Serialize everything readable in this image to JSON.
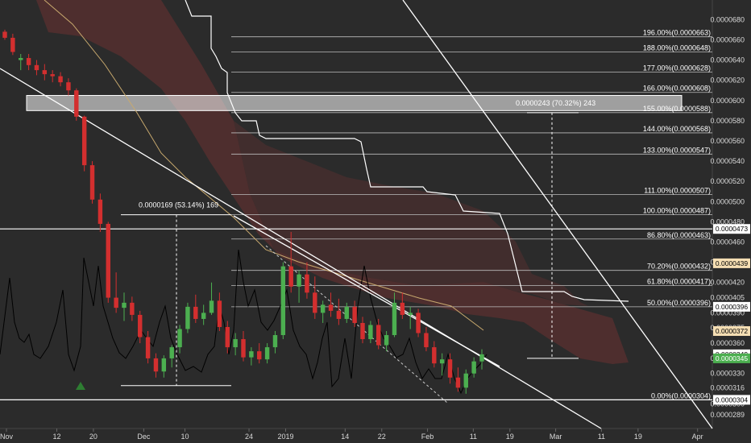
{
  "chart_data": {
    "type": "candlestick",
    "title": "",
    "y_axis": {
      "range": [
        2.82e-05,
        6.93e-05
      ],
      "ticks": [
        "0.0000680",
        "0.0000660",
        "0.0000640",
        "0.0000620",
        "0.0000600",
        "0.0000580",
        "0.0000560",
        "0.0000540",
        "0.0000520",
        "0.0000500",
        "0.0000480",
        "0.0000460",
        "0.0000440",
        "0.0000420",
        "0.0000405",
        "0.0000390",
        "0.0000375",
        "0.0000360",
        "0.0000345",
        "0.0000330",
        "0.0000316",
        "0.0000300",
        "0.0000289"
      ],
      "position": "right"
    },
    "x_axis": {
      "ticks": [
        {
          "label": "Nov",
          "day": 0
        },
        {
          "label": "12",
          "day": 11
        },
        {
          "label": "20",
          "day": 19
        },
        {
          "label": "Dec",
          "day": 30
        },
        {
          "label": "10",
          "day": 39
        },
        {
          "label": "24",
          "day": 53
        },
        {
          "label": "2019",
          "day": 61
        },
        {
          "label": "14",
          "day": 74
        },
        {
          "label": "22",
          "day": 82
        },
        {
          "label": "Feb",
          "day": 92
        },
        {
          "label": "11",
          "day": 102
        },
        {
          "label": "19",
          "day": 110
        },
        {
          "label": "Mar",
          "day": 120
        },
        {
          "label": "11",
          "day": 130
        },
        {
          "label": "19",
          "day": 138
        },
        {
          "label": "Apr",
          "day": 151
        }
      ]
    },
    "fib_levels": [
      {
        "label": "0.00%(0.0000304)",
        "price": 3.04e-05
      },
      {
        "label": "50.00%(0.0000396)",
        "price": 3.96e-05
      },
      {
        "label": "61.80%(0.0000417)",
        "price": 4.17e-05
      },
      {
        "label": "70.20%(0.0000432)",
        "price": 4.32e-05
      },
      {
        "label": "86.80%(0.0000463)",
        "price": 4.63e-05
      },
      {
        "label": "100.00%(0.0000487)",
        "price": 4.87e-05
      },
      {
        "label": "111.00%(0.0000507)",
        "price": 5.07e-05
      },
      {
        "label": "133.00%(0.0000547)",
        "price": 5.47e-05
      },
      {
        "label": "144.00%(0.0000568)",
        "price": 5.68e-05
      },
      {
        "label": "155.00%(0.0000588)",
        "price": 5.88e-05
      },
      {
        "label": "166.00%(0.0000608)",
        "price": 6.08e-05
      },
      {
        "label": "177.00%(0.0000628)",
        "price": 6.28e-05
      },
      {
        "label": "188.00%(0.0000648)",
        "price": 6.48e-05
      },
      {
        "label": "196.00%(0.0000663)",
        "price": 6.63e-05
      }
    ],
    "measurements": [
      {
        "label": "0.0000169 (53.14%) 169",
        "from_price": 3.18e-05,
        "to_price": 4.87e-05
      },
      {
        "label": "0.0000243 (70.32%) 243",
        "from_price": 3.45e-05,
        "to_price": 5.88e-05
      }
    ],
    "horizontal_lines": [
      4.73e-05,
      3.04e-05
    ],
    "resistance_zone": {
      "from_price": 5.9e-05,
      "to_price": 6.05e-05
    },
    "price_tags": [
      {
        "text": "0.0000473",
        "price": 4.73e-05,
        "bg": "#ffffff",
        "fg": "#000000"
      },
      {
        "text": "0.0000439",
        "price": 4.39e-05,
        "bg": "#f5deb3",
        "fg": "#000000"
      },
      {
        "text": "0.0000396",
        "price": 3.96e-05,
        "bg": "#ffffff",
        "fg": "#000000"
      },
      {
        "text": "0.0000372",
        "price": 3.72e-05,
        "bg": "#f5deb3",
        "fg": "#000000"
      },
      {
        "text": "0.0000349",
        "price": 3.49e-05,
        "bg": "#ffffff",
        "fg": "#000000"
      },
      {
        "text": "0.0000345",
        "price": 3.45e-05,
        "bg": "#4caf50",
        "fg": "#ffffff"
      },
      {
        "text": "0.0000304",
        "price": 3.04e-05,
        "bg": "#ffffff",
        "fg": "#000000"
      }
    ],
    "candles": [
      [
        6.68e-05,
        6.7e-05,
        6.6e-05,
        6.62e-05
      ],
      [
        6.62e-05,
        6.66e-05,
        6.45e-05,
        6.48e-05
      ],
      [
        6.4e-05,
        6.46e-05,
        6.3e-05,
        6.42e-05
      ],
      [
        6.42e-05,
        6.46e-05,
        6.3e-05,
        6.35e-05
      ],
      [
        6.35e-05,
        6.4e-05,
        6.25e-05,
        6.3e-05
      ],
      [
        6.3e-05,
        6.36e-05,
        6.2e-05,
        6.26e-05
      ],
      [
        6.26e-05,
        6.3e-05,
        6.18e-05,
        6.24e-05
      ],
      [
        6.24e-05,
        6.28e-05,
        6.14e-05,
        6.18e-05
      ],
      [
        6.18e-05,
        6.22e-05,
        6.05e-05,
        6.1e-05
      ],
      [
        6.1e-05,
        6.12e-05,
        5.8e-05,
        5.84e-05
      ],
      [
        5.84e-05,
        5.85e-05,
        5.3e-05,
        5.36e-05
      ],
      [
        5.36e-05,
        5.4e-05,
        4.98e-05,
        5.02e-05
      ],
      [
        5.02e-05,
        5.08e-05,
        4.7e-05,
        4.78e-05
      ],
      [
        4.78e-05,
        4.8e-05,
        4e-05,
        4.05e-05
      ],
      [
        4.05e-05,
        4.3e-05,
        3.9e-05,
        3.95e-05
      ],
      [
        3.95e-05,
        4.1e-05,
        3.82e-05,
        4e-05
      ],
      [
        4e-05,
        4.06e-05,
        3.82e-05,
        3.88e-05
      ],
      [
        3.88e-05,
        3.92e-05,
        3.6e-05,
        3.66e-05
      ],
      [
        3.66e-05,
        3.72e-05,
        3.4e-05,
        3.45e-05
      ],
      [
        3.45e-05,
        3.5e-05,
        3.26e-05,
        3.32e-05
      ],
      [
        3.32e-05,
        3.48e-05,
        3.26e-05,
        3.45e-05
      ],
      [
        3.45e-05,
        3.58e-05,
        3.36e-05,
        3.56e-05
      ],
      [
        3.56e-05,
        3.78e-05,
        3.5e-05,
        3.74e-05
      ],
      [
        3.74e-05,
        4e-05,
        3.7e-05,
        3.96e-05
      ],
      [
        3.96e-05,
        4.08e-05,
        3.8e-05,
        3.84e-05
      ],
      [
        3.84e-05,
        3.98e-05,
        3.78e-05,
        3.9e-05
      ],
      [
        3.9e-05,
        4.2e-05,
        3.88e-05,
        4.02e-05
      ],
      [
        4.02e-05,
        4.1e-05,
        3.72e-05,
        3.76e-05
      ],
      [
        3.76e-05,
        3.82e-05,
        3.5e-05,
        3.56e-05
      ],
      [
        3.56e-05,
        3.7e-05,
        3.48e-05,
        3.64e-05
      ],
      [
        3.64e-05,
        3.72e-05,
        3.42e-05,
        3.46e-05
      ],
      [
        3.46e-05,
        3.56e-05,
        3.38e-05,
        3.52e-05
      ],
      [
        3.52e-05,
        3.6e-05,
        3.4e-05,
        3.44e-05
      ],
      [
        3.44e-05,
        3.6e-05,
        3.4e-05,
        3.56e-05
      ],
      [
        3.56e-05,
        3.72e-05,
        3.5e-05,
        3.68e-05
      ],
      [
        3.68e-05,
        4.4e-05,
        3.64e-05,
        4.36e-05
      ],
      [
        4.36e-05,
        4.7e-05,
        4.1e-05,
        4.16e-05
      ],
      [
        4.16e-05,
        4.32e-05,
        4e-05,
        4.28e-05
      ],
      [
        4.28e-05,
        4.4e-05,
        4.04e-05,
        4.1e-05
      ],
      [
        4.1e-05,
        4.26e-05,
        3.84e-05,
        3.9e-05
      ],
      [
        3.9e-05,
        4.02e-05,
        3.8e-05,
        3.98e-05
      ],
      [
        3.98e-05,
        4.1e-05,
        3.86e-05,
        3.92e-05
      ],
      [
        3.92e-05,
        4.04e-05,
        3.78e-05,
        3.84e-05
      ],
      [
        3.84e-05,
        4e-05,
        3.8e-05,
        3.96e-05
      ],
      [
        3.96e-05,
        4.02e-05,
        3.76e-05,
        3.8e-05
      ],
      [
        3.8e-05,
        3.86e-05,
        3.6e-05,
        3.64e-05
      ],
      [
        3.64e-05,
        3.82e-05,
        3.6e-05,
        3.78e-05
      ],
      [
        3.78e-05,
        3.84e-05,
        3.54e-05,
        3.58e-05
      ],
      [
        3.58e-05,
        3.72e-05,
        3.52e-05,
        3.68e-05
      ],
      [
        3.68e-05,
        4.1e-05,
        3.66e-05,
        4e-05
      ],
      [
        4e-05,
        4.1e-05,
        3.84e-05,
        3.88e-05
      ],
      [
        3.88e-05,
        3.96e-05,
        3.74e-05,
        3.9e-05
      ],
      [
        3.9e-05,
        3.94e-05,
        3.66e-05,
        3.7e-05
      ],
      [
        3.7e-05,
        3.76e-05,
        3.52e-05,
        3.56e-05
      ],
      [
        3.56e-05,
        3.62e-05,
        3.36e-05,
        3.4e-05
      ],
      [
        3.4e-05,
        3.5e-05,
        3.28e-05,
        3.44e-05
      ],
      [
        3.44e-05,
        3.5e-05,
        3.2e-05,
        3.26e-05
      ],
      [
        3.26e-05,
        3.36e-05,
        3.12e-05,
        3.16e-05
      ],
      [
        3.16e-05,
        3.34e-05,
        3.1e-05,
        3.3e-05
      ],
      [
        3.3e-05,
        3.46e-05,
        3.26e-05,
        3.42e-05
      ],
      [
        3.42e-05,
        3.54e-05,
        3.34e-05,
        3.49e-05
      ]
    ]
  }
}
